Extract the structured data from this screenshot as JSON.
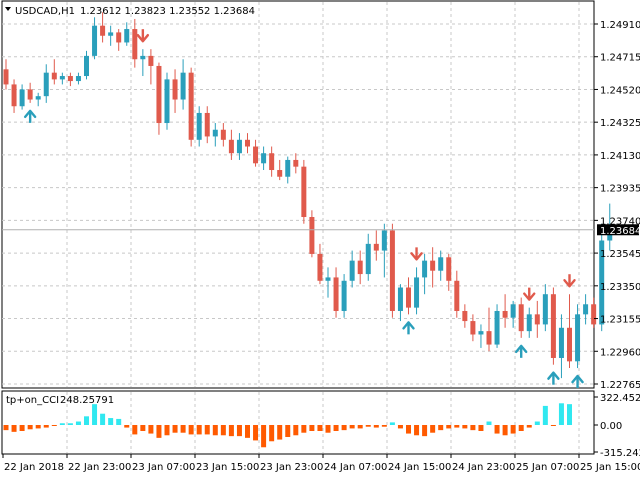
{
  "window": {
    "symbol": "USDCAD,H1",
    "ohlc": "1.23612 1.23823 1.23552 1.23684"
  },
  "indicator": {
    "name": "tp+on_CCI",
    "value": "248.25791"
  },
  "colors": {
    "bull": "#2a9fbb",
    "bear": "#e05a4c",
    "cci_pos": "#30e8f0",
    "cci_neg": "#ff5a00",
    "grid": "#c8c8c8",
    "current_price_bg": "#000000"
  },
  "chart_data": [
    {
      "type": "candlestick",
      "title": "USDCAD,H1",
      "price_axis_ticks": [
        "1.24910",
        "1.24715",
        "1.24520",
        "1.24325",
        "1.24130",
        "1.23935",
        "1.23740",
        "1.23545",
        "1.23350",
        "1.23155",
        "1.22960",
        "1.22765"
      ],
      "current_price": "1.23684",
      "ylim": [
        1.2272,
        1.2505
      ],
      "candles": [
        [
          1.2464,
          1.247,
          1.2452,
          1.2455
        ],
        [
          1.2455,
          1.2458,
          1.2438,
          1.2442
        ],
        [
          1.2442,
          1.2455,
          1.244,
          1.2452
        ],
        [
          1.2452,
          1.2456,
          1.2444,
          1.2446
        ],
        [
          1.2446,
          1.245,
          1.2442,
          1.2448
        ],
        [
          1.2448,
          1.2467,
          1.2444,
          1.2462
        ],
        [
          1.2462,
          1.247,
          1.2455,
          1.2458
        ],
        [
          1.2458,
          1.2462,
          1.2455,
          1.246
        ],
        [
          1.246,
          1.2462,
          1.2454,
          1.2457
        ],
        [
          1.2457,
          1.2462,
          1.2455,
          1.246
        ],
        [
          1.246,
          1.2475,
          1.2458,
          1.2472
        ],
        [
          1.2472,
          1.2495,
          1.247,
          1.249
        ],
        [
          1.249,
          1.2498,
          1.248,
          1.2484
        ],
        [
          1.2484,
          1.249,
          1.2478,
          1.2486
        ],
        [
          1.2486,
          1.2488,
          1.2475,
          1.248
        ],
        [
          1.248,
          1.2492,
          1.2478,
          1.2488
        ],
        [
          1.2488,
          1.2494,
          1.2465,
          1.247
        ],
        [
          1.247,
          1.2476,
          1.246,
          1.2472
        ],
        [
          1.2472,
          1.2476,
          1.2455,
          1.2466
        ],
        [
          1.2466,
          1.2468,
          1.2425,
          1.2432
        ],
        [
          1.2432,
          1.2462,
          1.2428,
          1.2458
        ],
        [
          1.2458,
          1.2464,
          1.2438,
          1.2446
        ],
        [
          1.2446,
          1.247,
          1.244,
          1.2462
        ],
        [
          1.2462,
          1.2465,
          1.2418,
          1.2422
        ],
        [
          1.2422,
          1.2442,
          1.2418,
          1.2438
        ],
        [
          1.2438,
          1.2442,
          1.242,
          1.2424
        ],
        [
          1.2424,
          1.2432,
          1.2418,
          1.2428
        ],
        [
          1.2428,
          1.2432,
          1.2418,
          1.2422
        ],
        [
          1.2422,
          1.2428,
          1.241,
          1.2414
        ],
        [
          1.2414,
          1.2426,
          1.241,
          1.2422
        ],
        [
          1.2422,
          1.2426,
          1.2414,
          1.2418
        ],
        [
          1.2418,
          1.2422,
          1.2406,
          1.2408
        ],
        [
          1.2408,
          1.2418,
          1.2404,
          1.2414
        ],
        [
          1.2414,
          1.2418,
          1.24,
          1.2404
        ],
        [
          1.2404,
          1.241,
          1.2398,
          1.24
        ],
        [
          1.24,
          1.2412,
          1.2396,
          1.241
        ],
        [
          1.241,
          1.2414,
          1.2402,
          1.2406
        ],
        [
          1.2406,
          1.241,
          1.2372,
          1.2376
        ],
        [
          1.2376,
          1.238,
          1.2352,
          1.2354
        ],
        [
          1.2354,
          1.236,
          1.2336,
          1.2338
        ],
        [
          1.2338,
          1.2346,
          1.2328,
          1.234
        ],
        [
          1.234,
          1.2346,
          1.2316,
          1.232
        ],
        [
          1.232,
          1.2342,
          1.2316,
          1.2338
        ],
        [
          1.2338,
          1.2356,
          1.2334,
          1.235
        ],
        [
          1.235,
          1.2356,
          1.2336,
          1.2342
        ],
        [
          1.2342,
          1.2366,
          1.2338,
          1.236
        ],
        [
          1.236,
          1.2368,
          1.235,
          1.2356
        ],
        [
          1.2356,
          1.2372,
          1.234,
          1.2368
        ],
        [
          1.2368,
          1.2372,
          1.2316,
          1.232
        ],
        [
          1.232,
          1.2336,
          1.2314,
          1.2334
        ],
        [
          1.2334,
          1.234,
          1.2318,
          1.2322
        ],
        [
          1.2322,
          1.2346,
          1.2318,
          1.234
        ],
        [
          1.234,
          1.2354,
          1.233,
          1.235
        ],
        [
          1.235,
          1.2358,
          1.2334,
          1.2344
        ],
        [
          1.2344,
          1.2356,
          1.2338,
          1.2352
        ],
        [
          1.2352,
          1.2354,
          1.2332,
          1.2338
        ],
        [
          1.2338,
          1.2344,
          1.2316,
          1.232
        ],
        [
          1.232,
          1.2324,
          1.231,
          1.2314
        ],
        [
          1.2314,
          1.2318,
          1.2302,
          1.2306
        ],
        [
          1.2306,
          1.2312,
          1.2298,
          1.2308
        ],
        [
          1.2308,
          1.2322,
          1.2296,
          1.23
        ],
        [
          1.23,
          1.2324,
          1.2298,
          1.232
        ],
        [
          1.232,
          1.233,
          1.231,
          1.2316
        ],
        [
          1.2316,
          1.2326,
          1.231,
          1.2324
        ],
        [
          1.2324,
          1.2328,
          1.2304,
          1.2308
        ],
        [
          1.2308,
          1.2322,
          1.2304,
          1.2318
        ],
        [
          1.2318,
          1.2326,
          1.2304,
          1.2312
        ],
        [
          1.2312,
          1.2336,
          1.2308,
          1.233
        ],
        [
          1.233,
          1.2334,
          1.2288,
          1.2292
        ],
        [
          1.2292,
          1.2318,
          1.228,
          1.231
        ],
        [
          1.231,
          1.233,
          1.2286,
          1.229
        ],
        [
          1.229,
          1.2324,
          1.2286,
          1.2318
        ],
        [
          1.2318,
          1.233,
          1.2312,
          1.2324
        ],
        [
          1.2324,
          1.2328,
          1.231,
          1.2312
        ],
        [
          1.2312,
          1.2372,
          1.2308,
          1.2362
        ],
        [
          1.2362,
          1.2384,
          1.2356,
          1.2368
        ]
      ],
      "signals": [
        {
          "index": 3,
          "type": "buy"
        },
        {
          "index": 17,
          "type": "sell"
        },
        {
          "index": 50,
          "type": "buy"
        },
        {
          "index": 51,
          "type": "sell"
        },
        {
          "index": 64,
          "type": "buy"
        },
        {
          "index": 65,
          "type": "sell"
        },
        {
          "index": 68,
          "type": "buy"
        },
        {
          "index": 70,
          "type": "sell"
        },
        {
          "index": 71,
          "type": "buy"
        }
      ]
    },
    {
      "type": "bar",
      "title": "tp+on_CCI 248.25791",
      "axis_ticks": [
        "322.4529",
        "0.00",
        "-315.2421"
      ],
      "ylim": [
        -315.2421,
        322.4529
      ],
      "values": [
        -60,
        -80,
        -70,
        -50,
        -40,
        -30,
        -10,
        20,
        20,
        40,
        100,
        240,
        130,
        80,
        70,
        -30,
        -110,
        -70,
        -100,
        -150,
        -120,
        -90,
        -90,
        -110,
        -110,
        -110,
        -120,
        -120,
        -130,
        -130,
        -150,
        -180,
        -260,
        -190,
        -170,
        -140,
        -120,
        -90,
        -70,
        -70,
        -90,
        -70,
        -60,
        -40,
        -40,
        -20,
        -30,
        -20,
        30,
        -40,
        -100,
        -120,
        -130,
        -90,
        -60,
        -40,
        -30,
        -40,
        -60,
        -70,
        40,
        -100,
        -120,
        -100,
        -70,
        -30,
        40,
        220,
        -10,
        250,
        240
      ]
    }
  ],
  "time_axis": [
    "22 Jan 2018",
    "22 Jan 23:00",
    "23 Jan 07:00",
    "23 Jan 15:00",
    "23 Jan 23:00",
    "24 Jan 07:00",
    "24 Jan 15:00",
    "24 Jan 23:00",
    "25 Jan 07:00",
    "25 Jan 15:00"
  ]
}
